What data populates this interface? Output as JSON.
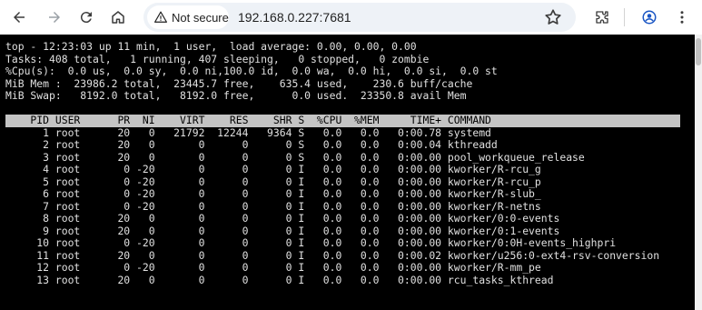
{
  "browser": {
    "security_label": "Not secure",
    "url": "192.168.0.227:7681"
  },
  "terminal": {
    "summary": [
      "top - 12:23:03 up 11 min,  1 user,  load average: 0.00, 0.00, 0.00",
      "Tasks: 408 total,   1 running, 407 sleeping,   0 stopped,   0 zombie",
      "%Cpu(s):  0.0 us,  0.0 sy,  0.0 ni,100.0 id,  0.0 wa,  0.0 hi,  0.0 si,  0.0 st",
      "MiB Mem :  23986.2 total,  23445.7 free,    635.4 used,    230.6 buff/cache",
      "MiB Swap:   8192.0 total,   8192.0 free,      0.0 used.  23350.8 avail Mem"
    ],
    "column_header": "    PID USER      PR  NI    VIRT    RES    SHR S  %CPU  %MEM     TIME+ COMMAND",
    "rows": [
      "      1 root      20   0   21792  12244   9364 S   0.0   0.0   0:00.78 systemd",
      "      2 root      20   0       0      0      0 S   0.0   0.0   0:00.04 kthreadd",
      "      3 root      20   0       0      0      0 S   0.0   0.0   0:00.00 pool_workqueue_release",
      "      4 root       0 -20       0      0      0 I   0.0   0.0   0:00.00 kworker/R-rcu_g",
      "      5 root       0 -20       0      0      0 I   0.0   0.0   0:00.00 kworker/R-rcu_p",
      "      6 root       0 -20       0      0      0 I   0.0   0.0   0:00.00 kworker/R-slub_",
      "      7 root       0 -20       0      0      0 I   0.0   0.0   0:00.00 kworker/R-netns",
      "      8 root      20   0       0      0      0 I   0.0   0.0   0:00.00 kworker/0:0-events",
      "      9 root      20   0       0      0      0 I   0.0   0.0   0:00.00 kworker/0:1-events",
      "     10 root       0 -20       0      0      0 I   0.0   0.0   0:00.00 kworker/0:0H-events_highpri",
      "     11 root      20   0       0      0      0 I   0.0   0.0   0:00.02 kworker/u256:0-ext4-rsv-conversion",
      "     12 root       0 -20       0      0      0 I   0.0   0.0   0:00.00 kworker/R-mm_pe",
      "     13 root      20   0       0      0      0 I   0.0   0.0   0:00.00 rcu_tasks_kthread"
    ]
  }
}
